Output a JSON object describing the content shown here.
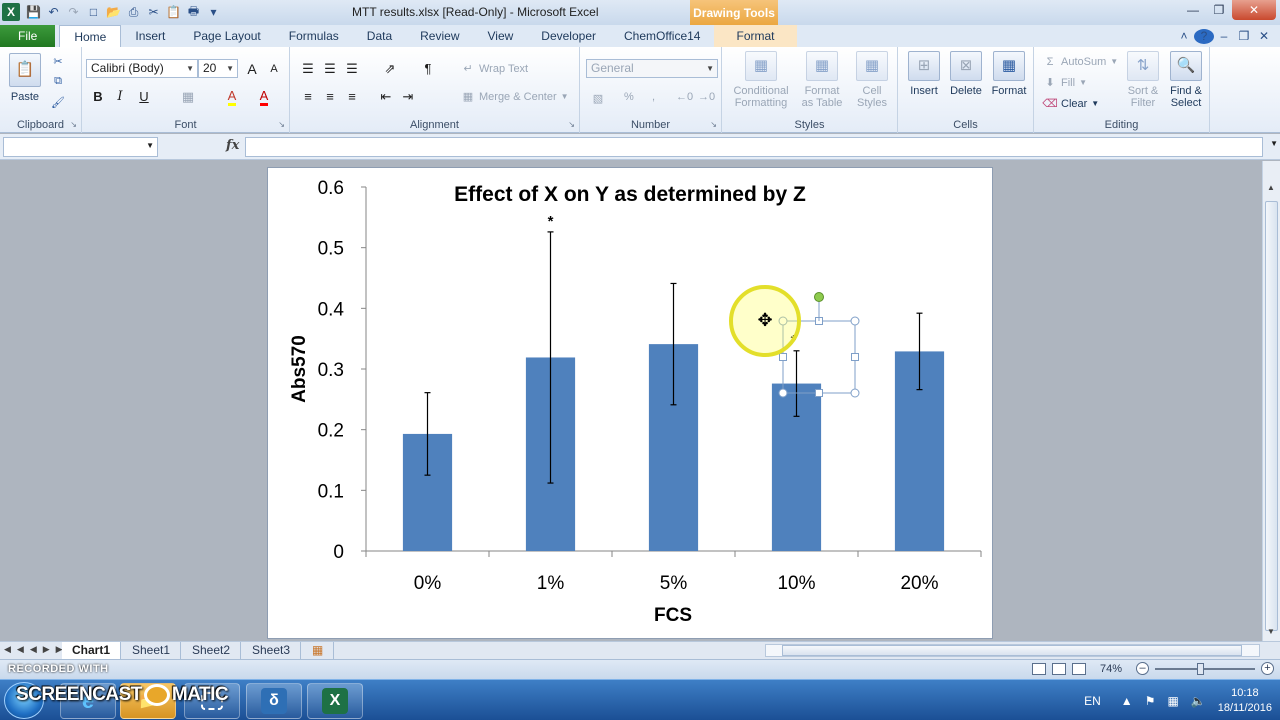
{
  "window": {
    "title": "MTT results.xlsx  [Read-Only]  -  Microsoft Excel",
    "context_tab_header": "Drawing Tools",
    "quick_access": [
      "save-icon",
      "undo-icon",
      "redo-icon",
      "new-file-icon",
      "open-folder-icon",
      "print-icon",
      "cut-icon",
      "paste-icon",
      "print-preview-icon",
      "customize-icon"
    ]
  },
  "tabs": [
    "File",
    "Home",
    "Insert",
    "Page Layout",
    "Formulas",
    "Data",
    "Review",
    "View",
    "Developer",
    "ChemOffice14",
    "Format"
  ],
  "active_tab": "Home",
  "ribbon": {
    "clipboard": {
      "title": "Clipboard",
      "paste": "Paste"
    },
    "font": {
      "title": "Font",
      "name": "Calibri (Body)",
      "size": "20",
      "bold": "B",
      "italic": "I",
      "underline": "U",
      "grow": "A",
      "shrink": "A",
      "fill": "A",
      "color": "A"
    },
    "alignment": {
      "title": "Alignment",
      "wrap": "Wrap Text",
      "merge": "Merge & Center"
    },
    "number": {
      "title": "Number",
      "format": "General",
      "percent": "%",
      "comma": ","
    },
    "styles": {
      "title": "Styles",
      "conditional_1": "Conditional",
      "conditional_2": "Formatting",
      "table_1": "Format",
      "table_2": "as Table",
      "cell_1": "Cell",
      "cell_2": "Styles"
    },
    "cells": {
      "title": "Cells",
      "insert": "Insert",
      "delete": "Delete",
      "format": "Format"
    },
    "editing": {
      "title": "Editing",
      "autosum": "AutoSum",
      "fill": "Fill",
      "clear": "Clear",
      "sort_1": "Sort &",
      "sort_2": "Filter",
      "find_1": "Find &",
      "find_2": "Select"
    }
  },
  "formula_bar": {
    "fx": "fx",
    "name_value": "",
    "formula_value": ""
  },
  "sheets": [
    "Chart1",
    "Sheet1",
    "Sheet2",
    "Sheet3"
  ],
  "active_sheet": "Chart1",
  "status": {
    "recorded": "RECORDED WITH",
    "zoom": "74%"
  },
  "taskbar": {
    "screencast": "SCREENCAST",
    "screencast_suffix": "MATIC",
    "lang": "EN",
    "time": "10:18",
    "date": "18/11/2016"
  },
  "colors": {
    "bar": "#4f81bd",
    "file_tab": "#2a8a2a",
    "context_tab": "#eba741",
    "selection": "#7f9fc8",
    "highlight": "#ffff66"
  },
  "chart_data": {
    "type": "bar",
    "title": "Effect of X on Y as determined by Z",
    "xlabel": "FCS",
    "ylabel": "Abs570",
    "categories": [
      "0%",
      "1%",
      "5%",
      "10%",
      "20%"
    ],
    "values": [
      0.193,
      0.319,
      0.341,
      0.276,
      0.329
    ],
    "error": [
      0.068,
      0.207,
      0.1,
      0.054,
      0.063
    ],
    "annotations": [
      {
        "category": "1%",
        "text": "*"
      },
      {
        "category": "10%",
        "text": "*"
      }
    ],
    "ylim": [
      0,
      0.6
    ],
    "yticks": [
      "0",
      "0.1",
      "0.2",
      "0.3",
      "0.4",
      "0.5",
      "0.6"
    ],
    "ytick_values": [
      0,
      0.1,
      0.2,
      0.3,
      0.4,
      0.5,
      0.6
    ],
    "grid": false,
    "legend": "none"
  }
}
